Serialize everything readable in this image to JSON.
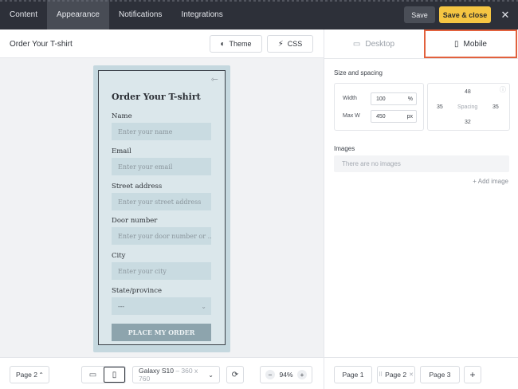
{
  "top_tabs": [
    {
      "label": "Content"
    },
    {
      "label": "Appearance"
    },
    {
      "label": "Notifications"
    },
    {
      "label": "Integrations"
    }
  ],
  "top_actions": {
    "save": "Save",
    "save_close": "Save & close",
    "close": "✕"
  },
  "colors": {
    "accent_yellow": "#f5c542",
    "topbar": "#2d3039",
    "highlight_border": "#e2613d"
  },
  "left": {
    "title": "Order Your T-shirt",
    "theme_button": "Theme",
    "css_button": "CSS"
  },
  "form": {
    "title": "Order Your T-shirt",
    "fields": [
      {
        "label": "Name",
        "placeholder": "Enter your name"
      },
      {
        "label": "Email",
        "placeholder": "Enter your email"
      },
      {
        "label": "Street address",
        "placeholder": "Enter your street address"
      },
      {
        "label": "Door number",
        "placeholder": "Enter your door number or ..."
      },
      {
        "label": "City",
        "placeholder": "Enter your city"
      }
    ],
    "state": {
      "label": "State/province",
      "value": "---"
    },
    "submit": "PLACE MY ORDER"
  },
  "left_bottom": {
    "page_select": "Page 2",
    "device": "Galaxy S10",
    "device_dims": "– 360 x 760",
    "zoom": "94%"
  },
  "right": {
    "tab_desktop": "Desktop",
    "tab_mobile": "Mobile",
    "size_spacing_label": "Size and spacing",
    "width_label": "Width",
    "width_value": "100",
    "width_unit": "%",
    "maxw_label": "Max W",
    "maxw_value": "450",
    "maxw_unit": "px",
    "spacing": {
      "top": "48",
      "left": "35",
      "center": "Spacing",
      "right": "35",
      "bottom": "32"
    },
    "images_label": "Images",
    "images_empty": "There are no images",
    "add_image": "+ Add image"
  },
  "pages": [
    {
      "label": "Page 1"
    },
    {
      "label": "Page 2"
    },
    {
      "label": "Page 3"
    }
  ]
}
